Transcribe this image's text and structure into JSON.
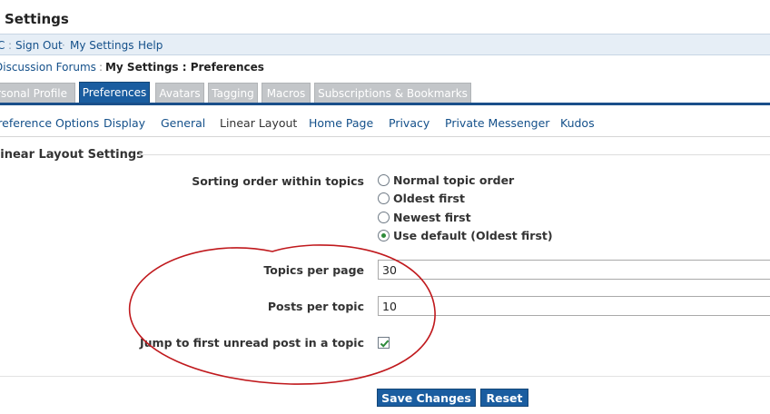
{
  "page": {
    "title": "Settings"
  },
  "userbar": {
    "items": [
      {
        "label": "C",
        "is_link": true
      },
      {
        "label": "Sign Out",
        "is_link": true
      },
      {
        "label": "My Settings",
        "is_link": true
      },
      {
        "label": "Help",
        "is_link": true
      }
    ],
    "first_separator": ":",
    "separator": "·"
  },
  "breadcrumb": {
    "items": [
      "Discussion Forums"
    ],
    "separator": ":",
    "current": "My Settings : Preferences"
  },
  "tabs": [
    {
      "label": "Personal Profile",
      "active": false
    },
    {
      "label": "Preferences",
      "active": true
    },
    {
      "label": "Avatars",
      "active": false
    },
    {
      "label": "Tagging",
      "active": false
    },
    {
      "label": "Macros",
      "active": false
    },
    {
      "label": "Subscriptions & Bookmarks",
      "active": false
    }
  ],
  "subnav": [
    {
      "label": "Preference Options",
      "current": false
    },
    {
      "label": "Display",
      "current": false
    },
    {
      "label": "General",
      "current": false
    },
    {
      "label": "Linear Layout",
      "current": true
    },
    {
      "label": "Home Page",
      "current": false
    },
    {
      "label": "Privacy",
      "current": false
    },
    {
      "label": "Private Messenger",
      "current": false
    },
    {
      "label": "Kudos",
      "current": false
    }
  ],
  "section": {
    "title": "Linear Layout Settings"
  },
  "sorting": {
    "label": "Sorting order within topics",
    "options": [
      {
        "label": "Normal topic order",
        "checked": false
      },
      {
        "label": "Oldest first",
        "checked": false
      },
      {
        "label": "Newest first",
        "checked": false
      },
      {
        "label": "Use default (Oldest first)",
        "checked": true
      }
    ]
  },
  "topics_per_page": {
    "label": "Topics per page",
    "value": "30"
  },
  "posts_per_topic": {
    "label": "Posts per topic",
    "value": "10"
  },
  "jump_unread": {
    "label": "Jump to first unread post in a topic",
    "checked": true
  },
  "buttons": {
    "save": "Save Changes",
    "reset": "Reset"
  },
  "colors": {
    "link": "#14508a",
    "tab_active": "#1a5da0",
    "tab_inactive": "#c3c6c9",
    "annotation": "#c0191d",
    "checkmark": "#2e8b3a"
  }
}
